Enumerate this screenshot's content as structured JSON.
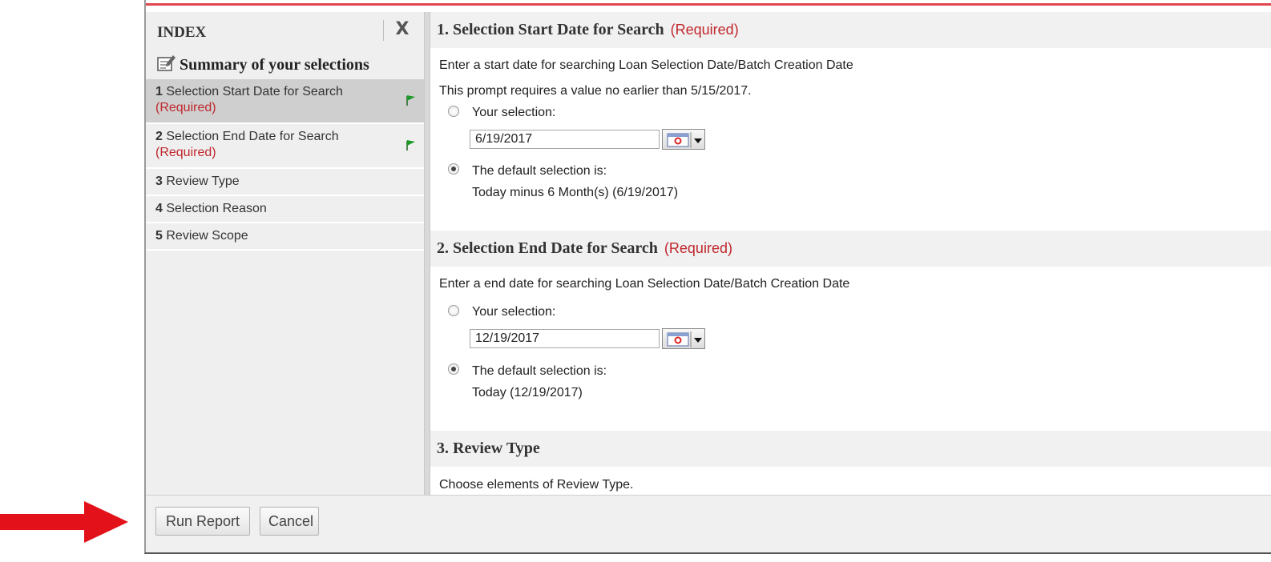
{
  "sidebar": {
    "index_title": "INDEX",
    "close_label": "X",
    "summary_label": "Summary of your selections",
    "items": [
      {
        "num": "1",
        "label": "Selection Start Date for Search",
        "required": "(Required)",
        "flag": "flag-icon"
      },
      {
        "num": "2",
        "label": "Selection End Date for Search",
        "required": "(Required)",
        "flag": "flag-icon"
      },
      {
        "num": "3",
        "label": "Review Type"
      },
      {
        "num": "4",
        "label": "Selection Reason"
      },
      {
        "num": "5",
        "label": "Review Scope"
      }
    ]
  },
  "sections": [
    {
      "title": "1. Selection Start Date for Search",
      "required": "(Required)",
      "description": "Enter a start date for searching Loan Selection Date/Batch Creation Date",
      "constraint": "This prompt requires a value no earlier than 5/15/2017.",
      "your_selection_label": "Your selection:",
      "date_value": "6/19/2017",
      "default_label": "The default selection is:",
      "default_value": "Today minus 6 Month(s) (6/19/2017)"
    },
    {
      "title": "2. Selection End Date for Search",
      "required": "(Required)",
      "description": "Enter a end date for searching Loan Selection Date/Batch Creation Date",
      "your_selection_label": "Your selection:",
      "date_value": "12/19/2017",
      "default_label": "The default selection is:",
      "default_value": "Today (12/19/2017)"
    },
    {
      "title": "3. Review Type",
      "description": "Choose elements of Review Type."
    }
  ],
  "footer": {
    "run_label": "Run Report",
    "cancel_label": "Cancel"
  },
  "colors": {
    "required": "#c0272d",
    "arrow": "#e3121a",
    "flag": "#1e9a2a",
    "topline": "#e0474f"
  }
}
